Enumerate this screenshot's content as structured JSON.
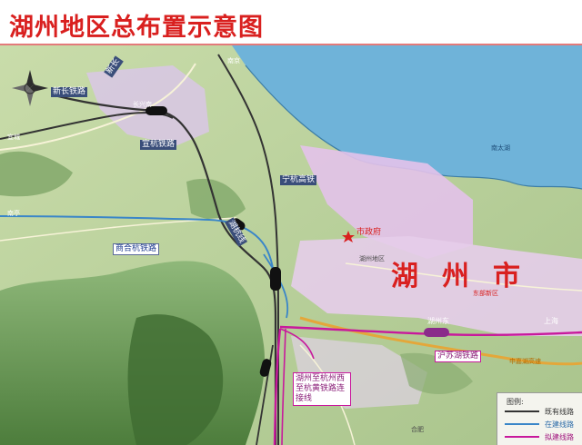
{
  "title": "湖州地区总布置示意图",
  "colors": {
    "title": "#d9201f",
    "existing_line": "#333333",
    "under_construction_line": "#3a86c8",
    "planned_line": "#c8199c",
    "lake": "#6fb3d9",
    "urban": "#e3c2ea"
  },
  "map": {
    "north_arrow_icon": "compass-rose-icon",
    "place_labels": {
      "city_name": "湖州市",
      "city_hall": "市政府",
      "south_taihu": "南太湖",
      "east_new_district": "东部新区",
      "huzhou_area": "湖州地区",
      "changxing_south": "长兴南",
      "huzhou_east": "湖州东",
      "shanghai": "上海",
      "nanjing": "南京",
      "yixing": "宜城",
      "nanji": "南亭",
      "hefei": "合肥"
    },
    "line_labels": {
      "xinchang": "新长铁路",
      "xinchang_short": "新长",
      "xuanhang": "宣杭铁路",
      "ninghang": "宁杭高铁",
      "shanghe_hang": "商合杭铁路",
      "huzhou_line": "湖杭线",
      "husuhu": "沪苏湖铁路",
      "connection": "湖州至杭州西至杭黄铁路连接线",
      "shenjiahu": "申嘉湖高速"
    }
  },
  "legend": {
    "title": "图例:",
    "items": [
      {
        "label": "既有线路",
        "color": "#333333"
      },
      {
        "label": "在建线路",
        "color": "#3a86c8"
      },
      {
        "label": "拟建线路",
        "color": "#c8199c"
      }
    ]
  }
}
